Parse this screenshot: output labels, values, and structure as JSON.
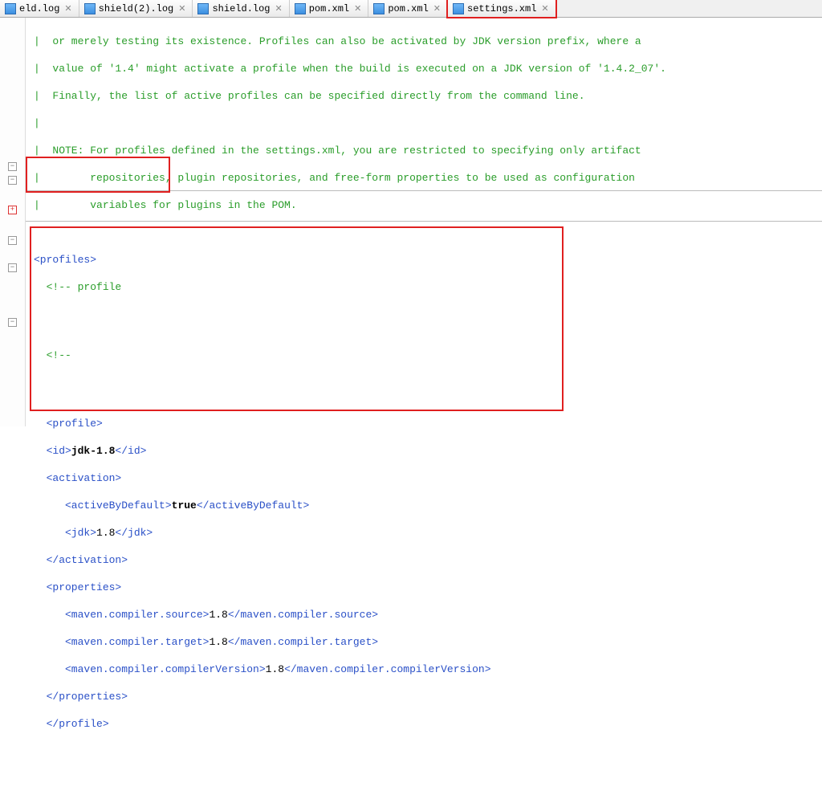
{
  "tabs": [
    {
      "label": "eld.log",
      "active": false
    },
    {
      "label": "shield(2).log",
      "active": false
    },
    {
      "label": "shield.log",
      "active": false
    },
    {
      "label": "pom.xml",
      "active": false
    },
    {
      "label": "pom.xml",
      "active": false
    },
    {
      "label": "settings.xml",
      "active": true
    }
  ],
  "close_glyph": "✕",
  "fold_expand": "+",
  "fold_collapse": "−",
  "comments": {
    "l1": "|  or merely testing its existence. Profiles can also be activated by JDK version prefix, where a",
    "l2": "|  value of '1.4' might activate a profile when the build is executed on a JDK version of '1.4.2_07'.",
    "l3": "|  Finally, the list of active profiles can be specified directly from the command line.",
    "l4": "|",
    "l5": "|  NOTE: For profiles defined in the settings.xml, you are restricted to specifying only artifact",
    "l6": "|        repositories, plugin repositories, and free-form properties to be used as configuration",
    "l7": "|        variables for plugins in the POM."
  },
  "profiles_open": "<profiles>",
  "profile_comment": "  <!-- profile",
  "dash_comment": "  <!--",
  "prof": {
    "open": "  <profile>",
    "id_open": "  <id>",
    "id_val": "jdk-1.8",
    "id_close": "</id>",
    "act_open": "  <activation>",
    "abd_open": "     <activeByDefault>",
    "abd_val": "true",
    "abd_close": "</activeByDefault>",
    "jdk_open": "     <jdk>",
    "jdk_val": "1.8",
    "jdk_close": "</jdk>",
    "act_close": "  </activation>",
    "props_open": "  <properties>",
    "src_open": "     <maven.compiler.source>",
    "src_val": "1.8",
    "src_close": "</maven.compiler.source>",
    "tgt_open": "     <maven.compiler.target>",
    "tgt_val": "1.8",
    "tgt_close": "</maven.compiler.target>",
    "cv_open": "     <maven.compiler.compilerVersion>",
    "cv_val": "1.8",
    "cv_close": "</maven.compiler.compilerVersion>",
    "props_close": "  </properties>",
    "close": "  </profile>"
  }
}
